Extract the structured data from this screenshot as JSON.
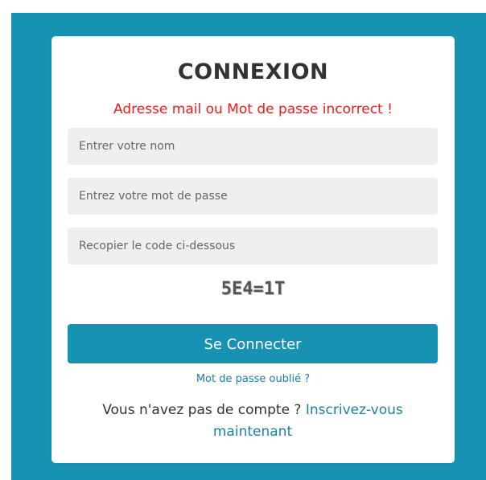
{
  "login": {
    "title": "CONNEXION",
    "error_message": "Adresse mail ou Mot de passe incorrect !",
    "username_placeholder": "Entrer votre nom",
    "password_placeholder": "Entrez votre mot de passe",
    "captcha_placeholder": "Recopier le code ci-dessous",
    "captcha_code": "5E4=1T",
    "submit_label": "Se Connecter",
    "forgot_password_link": "Mot de passe oublié ?",
    "no_account_text": "Vous n'avez pas de compte ? ",
    "signup_link": "Inscrivez-vous maintenant"
  },
  "colors": {
    "background": "#1892b3",
    "accent": "#1892b3",
    "error": "#f01b1b",
    "link": "#1c7fa6",
    "input_background": "#efefef"
  }
}
